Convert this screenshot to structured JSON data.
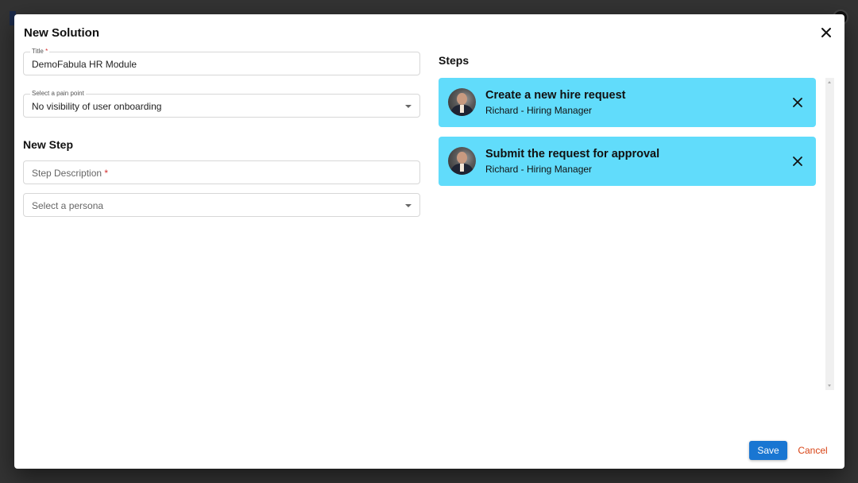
{
  "dialog": {
    "title": "New Solution",
    "close_icon": "close-icon"
  },
  "form": {
    "title_field": {
      "label": "Title",
      "required_mark": "*",
      "value": "DemoFabula HR Module"
    },
    "pain_point_select": {
      "label": "Select a pain point",
      "value": "No visibility of user onboarding"
    }
  },
  "new_step": {
    "heading": "New Step",
    "description_field": {
      "placeholder": "Step Description",
      "required_mark": "*"
    },
    "persona_select": {
      "placeholder": "Select a persona"
    }
  },
  "steps": {
    "heading": "Steps",
    "items": [
      {
        "title": "Create a new hire request",
        "persona": "Richard - Hiring Manager"
      },
      {
        "title": "Submit the request for approval",
        "persona": "Richard - Hiring Manager"
      }
    ]
  },
  "actions": {
    "save_label": "Save",
    "cancel_label": "Cancel"
  },
  "colors": {
    "step_card": "#61dcfb",
    "primary": "#1976d2",
    "cancel": "#d84315",
    "required": "#d32f2f"
  }
}
